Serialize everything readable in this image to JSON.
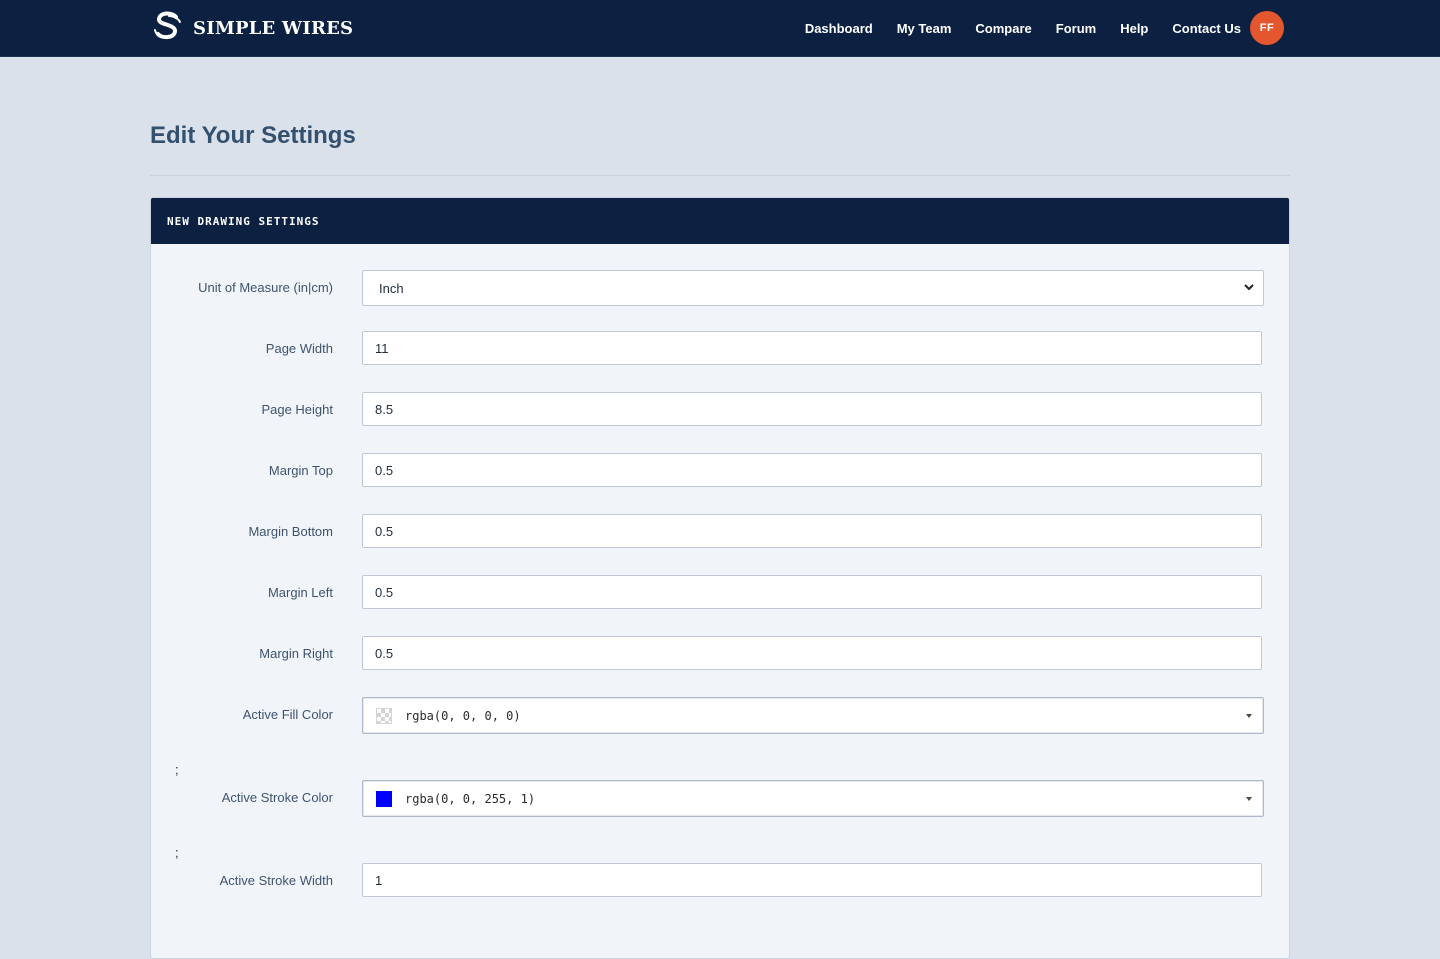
{
  "brand": {
    "name": "SIMPLE WIRES",
    "logo_icon": "simple-wires-logo-icon"
  },
  "nav": {
    "items": [
      "Dashboard",
      "My Team",
      "Compare",
      "Forum",
      "Help",
      "Contact Us"
    ],
    "avatar_initials": "FF"
  },
  "page": {
    "title": "Edit Your Settings"
  },
  "card": {
    "title": "NEW DRAWING SETTINGS"
  },
  "settings": {
    "unit": {
      "label": "Unit of Measure (in|cm)",
      "value": "Inch"
    },
    "page_width": {
      "label": "Page Width",
      "value": "11"
    },
    "page_height": {
      "label": "Page Height",
      "value": "8.5"
    },
    "margin_top": {
      "label": "Margin Top",
      "value": "0.5"
    },
    "margin_bottom": {
      "label": "Margin Bottom",
      "value": "0.5"
    },
    "margin_left": {
      "label": "Margin Left",
      "value": "0.5"
    },
    "margin_right": {
      "label": "Margin Right",
      "value": "0.5"
    },
    "fill_color": {
      "label": "Active Fill Color",
      "value": "rgba(0, 0, 0, 0)",
      "swatch": "transparent"
    },
    "stroke_color": {
      "label": "Active Stroke Color",
      "value": "rgba(0, 0, 255, 1)",
      "swatch": "#0000ff"
    },
    "stroke_width": {
      "label": "Active Stroke Width",
      "value": "1"
    },
    "stray_semicolon": ";"
  },
  "colors": {
    "navbar": "#0c2142",
    "background": "#dae1eb",
    "avatar": "#e4572e"
  }
}
